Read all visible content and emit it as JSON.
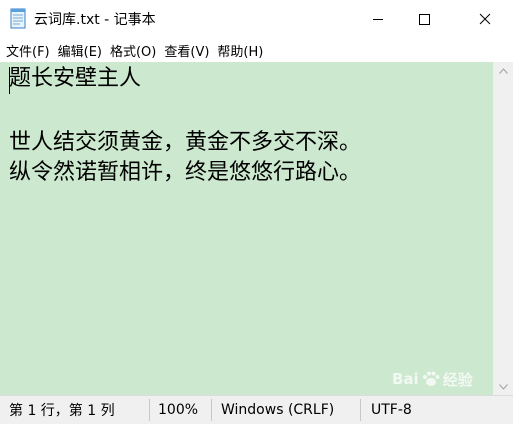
{
  "window": {
    "title": "云词库.txt - 记事本"
  },
  "menu": {
    "items": [
      {
        "label": "文件(F)"
      },
      {
        "label": "编辑(E)"
      },
      {
        "label": "格式(O)"
      },
      {
        "label": "查看(V)"
      },
      {
        "label": "帮助(H)"
      }
    ]
  },
  "editor": {
    "lines": [
      "题长安壁主人",
      "",
      "世人结交须黄金，黄金不多交不深。",
      "纵令然诺暂相许，终是悠悠行路心。"
    ],
    "background": "#cce8cf"
  },
  "status": {
    "position": "第 1 行，第 1 列",
    "zoom": "100%",
    "line_ending": "Windows (CRLF)",
    "encoding": "UTF-8"
  },
  "watermark": {
    "left_text": "Bai",
    "right_text": "经验"
  },
  "icons": {
    "app": "notepad-icon",
    "minimize": "minimize-icon",
    "maximize": "maximize-icon",
    "close": "close-icon",
    "scroll_up": "chevron-up-icon",
    "scroll_down": "chevron-down-icon"
  }
}
